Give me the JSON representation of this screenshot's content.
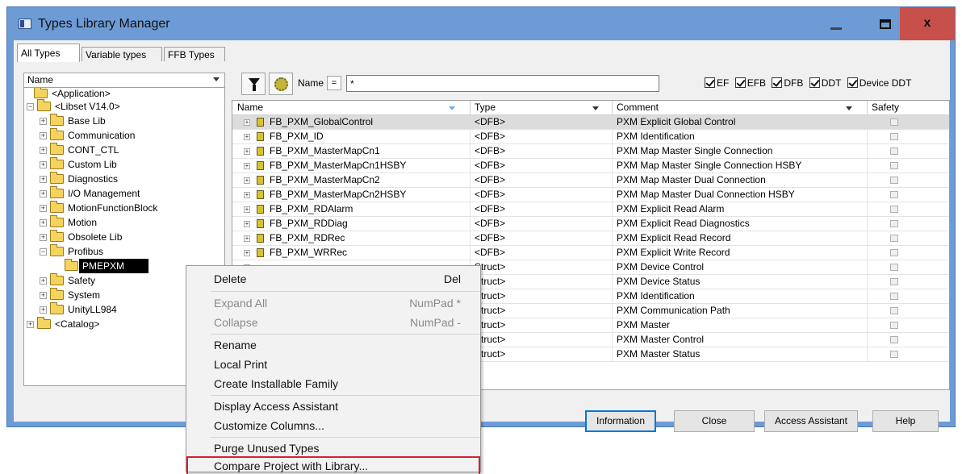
{
  "window": {
    "title": "Types Library Manager",
    "close_label": "x"
  },
  "tabs": [
    "All Types",
    "Variable types",
    "FFB Types"
  ],
  "tree": {
    "header": "Name",
    "nodes": [
      "<Application>",
      "<Libset V14.0>",
      "Base Lib",
      "Communication",
      "CONT_CTL",
      "Custom Lib",
      "Diagnostics",
      "I/O Management",
      "MotionFunctionBlock",
      "Motion",
      "Obsolete Lib",
      "Profibus",
      "PMEPXM",
      "Safety",
      "System",
      "UnityLL984",
      "<Catalog>"
    ]
  },
  "toolbar": {
    "name_label": "Name",
    "eq": "=",
    "filter_value": "*",
    "checks": [
      "EF",
      "EFB",
      "DFB",
      "DDT",
      "Device DDT"
    ]
  },
  "grid": {
    "columns": [
      "Name",
      "Type",
      "Comment",
      "Safety"
    ],
    "rows": [
      {
        "name": "FB_PXM_GlobalControl",
        "type": "<DFB>",
        "comment": "PXM Explicit Global Control"
      },
      {
        "name": "FB_PXM_ID",
        "type": "<DFB>",
        "comment": "PXM Identification"
      },
      {
        "name": "FB_PXM_MasterMapCn1",
        "type": "<DFB>",
        "comment": "PXM Map Master Single Connection"
      },
      {
        "name": "FB_PXM_MasterMapCn1HSBY",
        "type": "<DFB>",
        "comment": "PXM Map Master Single Connection HSBY"
      },
      {
        "name": "FB_PXM_MasterMapCn2",
        "type": "<DFB>",
        "comment": "PXM Map Master Dual Connection"
      },
      {
        "name": "FB_PXM_MasterMapCn2HSBY",
        "type": "<DFB>",
        "comment": "PXM Map Master Dual Connection HSBY"
      },
      {
        "name": "FB_PXM_RDAlarm",
        "type": "<DFB>",
        "comment": "PXM Explicit Read Alarm"
      },
      {
        "name": "FB_PXM_RDDiag",
        "type": "<DFB>",
        "comment": "PXM Explicit Read Diagnostics"
      },
      {
        "name": "FB_PXM_RDRec",
        "type": "<DFB>",
        "comment": "PXM Explicit Read Record"
      },
      {
        "name": "FB_PXM_WRRec",
        "type": "<DFB>",
        "comment": "PXM Explicit Write Record"
      },
      {
        "name": "",
        "type": "Struct>",
        "comment": "PXM Device Control"
      },
      {
        "name": "",
        "type": "Struct>",
        "comment": "PXM Device Status"
      },
      {
        "name": "",
        "type": "Struct>",
        "comment": "PXM Identification"
      },
      {
        "name": "",
        "type": "Struct>",
        "comment": "PXM Communication Path"
      },
      {
        "name": "",
        "type": "Struct>",
        "comment": "PXM Master"
      },
      {
        "name": "",
        "type": "Struct>",
        "comment": "PXM Master Control"
      },
      {
        "name": "",
        "type": "Struct>",
        "comment": "PXM Master Status"
      }
    ]
  },
  "buttons": {
    "information": "Information",
    "close": "Close",
    "access_assistant": "Access Assistant",
    "help": "Help"
  },
  "context_menu": [
    {
      "label": "Delete",
      "shortcut": "Del"
    },
    {
      "label": "Expand All",
      "shortcut": "NumPad *"
    },
    {
      "label": "Collapse",
      "shortcut": "NumPad -"
    },
    {
      "label": "Rename",
      "shortcut": ""
    },
    {
      "label": "Local Print",
      "shortcut": ""
    },
    {
      "label": "Create Installable Family",
      "shortcut": ""
    },
    {
      "label": "Display Access Assistant",
      "shortcut": ""
    },
    {
      "label": "Customize Columns...",
      "shortcut": ""
    },
    {
      "label": "Purge Unused Types",
      "shortcut": ""
    },
    {
      "label": "Compare Project with Library...",
      "shortcut": ""
    }
  ],
  "colors": {
    "titlebar": "#6d9bd6",
    "close": "#c7504b",
    "highlight_border": "#d5202f"
  }
}
